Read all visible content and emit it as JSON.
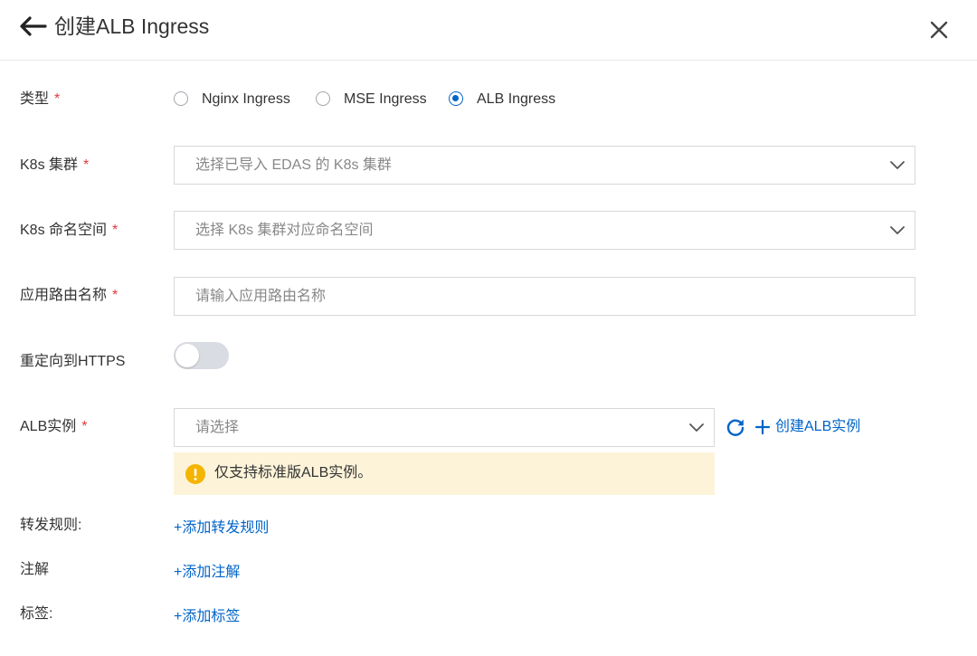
{
  "header": {
    "back_icon": "arrow-left-icon",
    "title": "创建ALB Ingress",
    "close_icon": "close-icon"
  },
  "form": {
    "type": {
      "label": "类型",
      "required_mark": "*",
      "options": [
        "Nginx Ingress",
        "MSE Ingress",
        "ALB Ingress"
      ],
      "selected": "ALB Ingress"
    },
    "cluster": {
      "label": "K8s 集群",
      "required_mark": "*",
      "placeholder": "选择已导入 EDAS 的 K8s 集群"
    },
    "namespace": {
      "label": "K8s 命名空间",
      "required_mark": "*",
      "placeholder": "选择 K8s 集群对应命名空间"
    },
    "route_name": {
      "label": "应用路由名称",
      "required_mark": "*",
      "placeholder": "请输入应用路由名称",
      "value": ""
    },
    "https_redirect": {
      "label": "重定向到HTTPS",
      "enabled": false
    },
    "alb_instance": {
      "label": "ALB实例",
      "required_mark": "*",
      "placeholder": "请选择",
      "refresh_icon": "refresh-icon",
      "create_label": "创建ALB实例",
      "alert_text": "仅支持标准版ALB实例。",
      "alert_icon": "warning-icon"
    },
    "forward_rules": {
      "label": "转发规则:",
      "add_link": "+添加转发规则"
    },
    "annotations": {
      "label": "注解",
      "add_link": "+添加注解"
    },
    "tags": {
      "label": "标签:",
      "add_link": "+添加标签"
    }
  },
  "colors": {
    "primary": "#0064c8",
    "required": "#e5383b",
    "alert_bg": "#fcf3d9",
    "alert_icon": "#f5b400",
    "toggle_off": "#d9dce2"
  }
}
